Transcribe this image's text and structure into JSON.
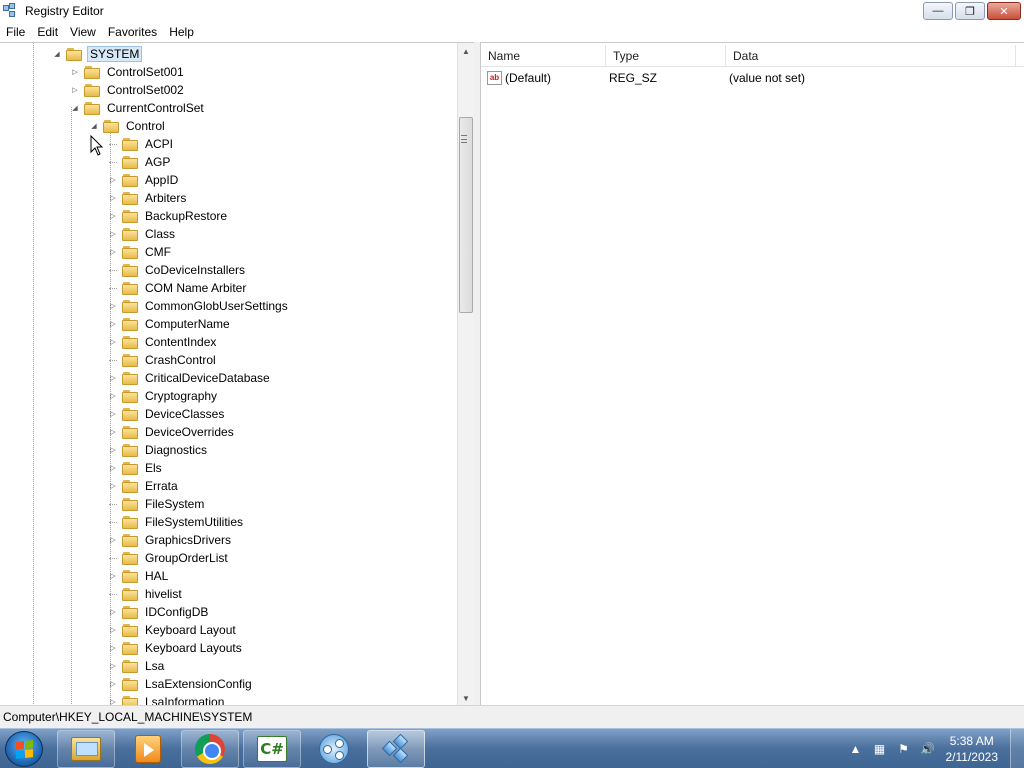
{
  "window": {
    "title": "Registry Editor"
  },
  "menubar": {
    "items": [
      "File",
      "Edit",
      "View",
      "Favorites",
      "Help"
    ]
  },
  "tree": {
    "nodes": [
      {
        "label": "SYSTEM",
        "state": "expanded",
        "selected": true
      },
      {
        "label": "ControlSet001",
        "state": "collapsed"
      },
      {
        "label": "ControlSet002",
        "state": "collapsed"
      },
      {
        "label": "CurrentControlSet",
        "state": "expanded"
      },
      {
        "label": "Control",
        "state": "expanded"
      },
      {
        "label": "ACPI",
        "state": "leaf"
      },
      {
        "label": "AGP",
        "state": "leaf"
      },
      {
        "label": "AppID",
        "state": "collapsed"
      },
      {
        "label": "Arbiters",
        "state": "collapsed"
      },
      {
        "label": "BackupRestore",
        "state": "collapsed"
      },
      {
        "label": "Class",
        "state": "collapsed"
      },
      {
        "label": "CMF",
        "state": "collapsed"
      },
      {
        "label": "CoDeviceInstallers",
        "state": "leaf"
      },
      {
        "label": "COM Name Arbiter",
        "state": "leaf"
      },
      {
        "label": "CommonGlobUserSettings",
        "state": "collapsed"
      },
      {
        "label": "ComputerName",
        "state": "collapsed"
      },
      {
        "label": "ContentIndex",
        "state": "collapsed"
      },
      {
        "label": "CrashControl",
        "state": "leaf"
      },
      {
        "label": "CriticalDeviceDatabase",
        "state": "collapsed"
      },
      {
        "label": "Cryptography",
        "state": "collapsed"
      },
      {
        "label": "DeviceClasses",
        "state": "collapsed"
      },
      {
        "label": "DeviceOverrides",
        "state": "collapsed"
      },
      {
        "label": "Diagnostics",
        "state": "collapsed"
      },
      {
        "label": "Els",
        "state": "collapsed"
      },
      {
        "label": "Errata",
        "state": "collapsed"
      },
      {
        "label": "FileSystem",
        "state": "leaf"
      },
      {
        "label": "FileSystemUtilities",
        "state": "leaf"
      },
      {
        "label": "GraphicsDrivers",
        "state": "collapsed"
      },
      {
        "label": "GroupOrderList",
        "state": "leaf"
      },
      {
        "label": "HAL",
        "state": "collapsed"
      },
      {
        "label": "hivelist",
        "state": "leaf"
      },
      {
        "label": "IDConfigDB",
        "state": "collapsed"
      },
      {
        "label": "Keyboard Layout",
        "state": "collapsed"
      },
      {
        "label": "Keyboard Layouts",
        "state": "collapsed"
      },
      {
        "label": "Lsa",
        "state": "collapsed"
      },
      {
        "label": "LsaExtensionConfig",
        "state": "collapsed"
      },
      {
        "label": "LsaInformation",
        "state": "collapsed"
      }
    ]
  },
  "listview": {
    "columns": {
      "name": "Name",
      "type": "Type",
      "data": "Data"
    },
    "rows": [
      {
        "icon": "string-value-icon",
        "icon_text": "ab",
        "name": "(Default)",
        "type": "REG_SZ",
        "data": "(value not set)"
      }
    ]
  },
  "statusbar": {
    "path": "Computer\\HKEY_LOCAL_MACHINE\\SYSTEM"
  },
  "taskbar": {
    "apps": [
      {
        "name": "explorer",
        "icon": "folder-icon"
      },
      {
        "name": "media-player",
        "icon": "media-player-icon"
      },
      {
        "name": "chrome",
        "icon": "chrome-icon"
      },
      {
        "name": "csharp",
        "icon": "csharp-icon",
        "icon_text": "C#"
      },
      {
        "name": "circles-app",
        "icon": "circles-app-icon"
      },
      {
        "name": "registry-editor",
        "icon": "regedit-icon",
        "active": true
      }
    ],
    "clock": {
      "time": "5:38 AM",
      "date": "2/11/2023"
    }
  },
  "colors": {
    "selection": "#d9e8f7",
    "folder": "#e7bb4a",
    "taskbar": "#4a6f9c"
  }
}
